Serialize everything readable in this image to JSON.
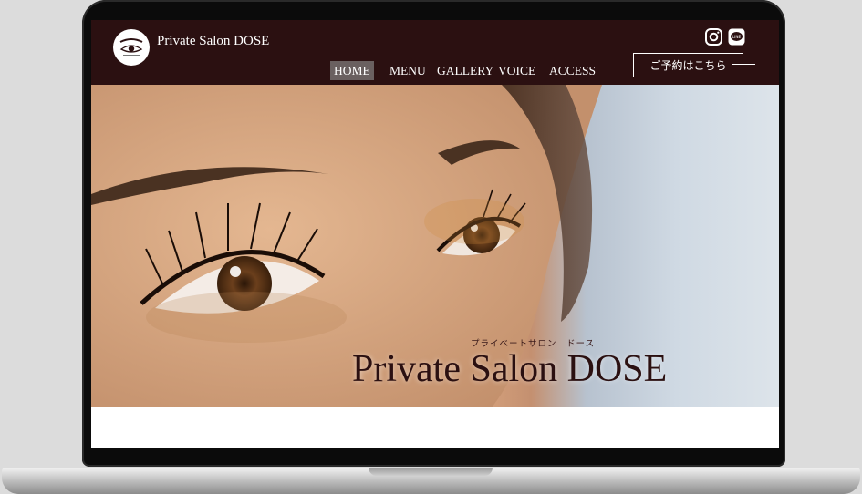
{
  "site": {
    "name": "Private Salon DOSE"
  },
  "nav": {
    "items": [
      {
        "label": "HOME",
        "active": true
      },
      {
        "label": "MENU",
        "active": false
      },
      {
        "label": "GALLERY",
        "active": false
      },
      {
        "label": "VOICE",
        "active": false
      },
      {
        "label": "ACCESS",
        "active": false
      }
    ],
    "reserve_label": "ご予約はこちら"
  },
  "social": {
    "icons": [
      "instagram-icon",
      "line-icon"
    ],
    "line_text": "LINE"
  },
  "hero": {
    "ruby": "プライベートサロン　ドース",
    "title": "Private Salon DOSE"
  },
  "colors": {
    "header_bg": "#2b1011",
    "active_nav_bg": "#6a6060",
    "title_text": "#2b1011"
  }
}
